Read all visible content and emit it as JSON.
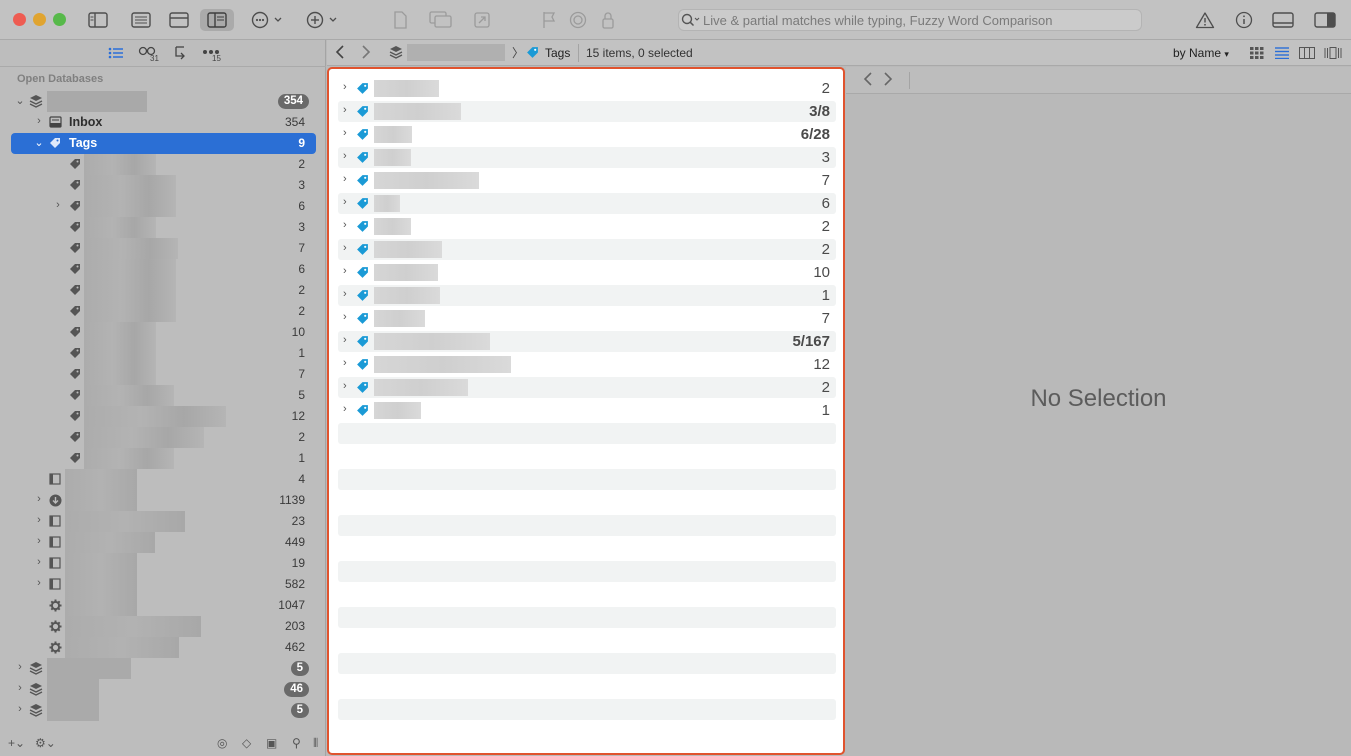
{
  "toolbar": {
    "traffic_lights": {
      "close": "#ee5c52",
      "minimize": "#e0a430",
      "zoom": "#57b94a"
    },
    "icons": [
      "sidebar-toggle-icon",
      "list-view-icon",
      "preview-view-icon",
      "split-view-icon",
      "more-actions-icon",
      "add-icon",
      "document-icon",
      "windows-icon",
      "share-icon",
      "flag-icon",
      "target-icon",
      "lock-icon",
      "warning-icon",
      "info-icon",
      "bottom-panel-icon",
      "inspector-icon"
    ],
    "search_placeholder": "Live & partial matches while typing, Fuzzy Word Comparison"
  },
  "sidebar": {
    "head_badges": {
      "links": "31",
      "more": "15"
    },
    "section_title": "Open Databases",
    "database": {
      "count": "354"
    },
    "inbox": {
      "label": "Inbox",
      "count": "354"
    },
    "tags": {
      "label": "Tags",
      "count": "9"
    },
    "tag_counts": [
      "2",
      "3",
      "6",
      "3",
      "7",
      "6",
      "2",
      "2",
      "10",
      "1",
      "7",
      "5",
      "12",
      "2",
      "1"
    ],
    "groups": [
      {
        "icon": "group-icon",
        "count": "4"
      },
      {
        "icon": "download-icon",
        "count": "1139"
      },
      {
        "icon": "group-icon",
        "count": "23"
      },
      {
        "icon": "group-icon",
        "count": "449"
      },
      {
        "icon": "group-icon",
        "count": "19"
      },
      {
        "icon": "group-icon",
        "count": "582"
      },
      {
        "icon": "gear-icon",
        "count": "1047"
      },
      {
        "icon": "gear-icon",
        "count": "203"
      },
      {
        "icon": "gear-icon",
        "count": "462"
      }
    ],
    "other_databases": [
      "5",
      "46",
      "5"
    ]
  },
  "pathbar": {
    "crumb": "Tags",
    "status": "15 items, 0 selected",
    "sort": "by Name"
  },
  "list": {
    "items": [
      {
        "count": "2",
        "bold": false
      },
      {
        "count": "3/8",
        "bold": true
      },
      {
        "count": "6/28",
        "bold": true
      },
      {
        "count": "3",
        "bold": false
      },
      {
        "count": "7",
        "bold": false
      },
      {
        "count": "6",
        "bold": false
      },
      {
        "count": "2",
        "bold": false
      },
      {
        "count": "2",
        "bold": false
      },
      {
        "count": "10",
        "bold": false
      },
      {
        "count": "1",
        "bold": false
      },
      {
        "count": "7",
        "bold": false
      },
      {
        "count": "5/167",
        "bold": true
      },
      {
        "count": "12",
        "bold": false
      },
      {
        "count": "2",
        "bold": false
      },
      {
        "count": "1",
        "bold": false
      }
    ],
    "tag_color": "#1a9ad6"
  },
  "preview": {
    "placeholder": "No Selection"
  }
}
